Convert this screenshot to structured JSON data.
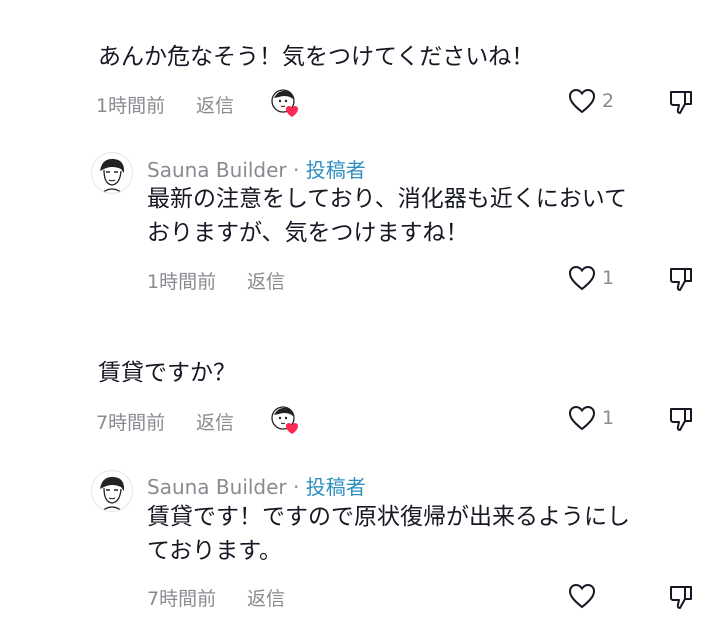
{
  "comments": [
    {
      "text": "あんか危なそう！気をつけてくださいね！",
      "time": "1時間前",
      "reply": "返信",
      "likes": "2",
      "liked_by_creator": true,
      "reply_item": {
        "author": "Sauna Builder",
        "separator": "·",
        "badge": "投稿者",
        "text_lines": [
          "最新の注意をしており、消化器も近くにおいて",
          "おりますが、気をつけますね！"
        ],
        "time": "1時間前",
        "reply": "返信",
        "likes": "1"
      }
    },
    {
      "text": "賃貸ですか？",
      "time": "7時間前",
      "reply": "返信",
      "likes": "1",
      "liked_by_creator": true,
      "reply_item": {
        "author": "Sauna Builder",
        "separator": "·",
        "badge": "投稿者",
        "text_lines": [
          "賃貸です！ですので原状復帰が出来るようにし",
          "ております。"
        ],
        "time": "7時間前",
        "reply": "返信",
        "likes": ""
      }
    }
  ],
  "icons": {
    "like": "heart-outline-icon",
    "dislike": "thumbs-down-icon",
    "creator_like": "creator-avatar-heart-icon"
  },
  "colors": {
    "text": "#161823",
    "muted": "#8a8b91",
    "badge": "#2f8fbf",
    "heart": "#fe2c55"
  }
}
